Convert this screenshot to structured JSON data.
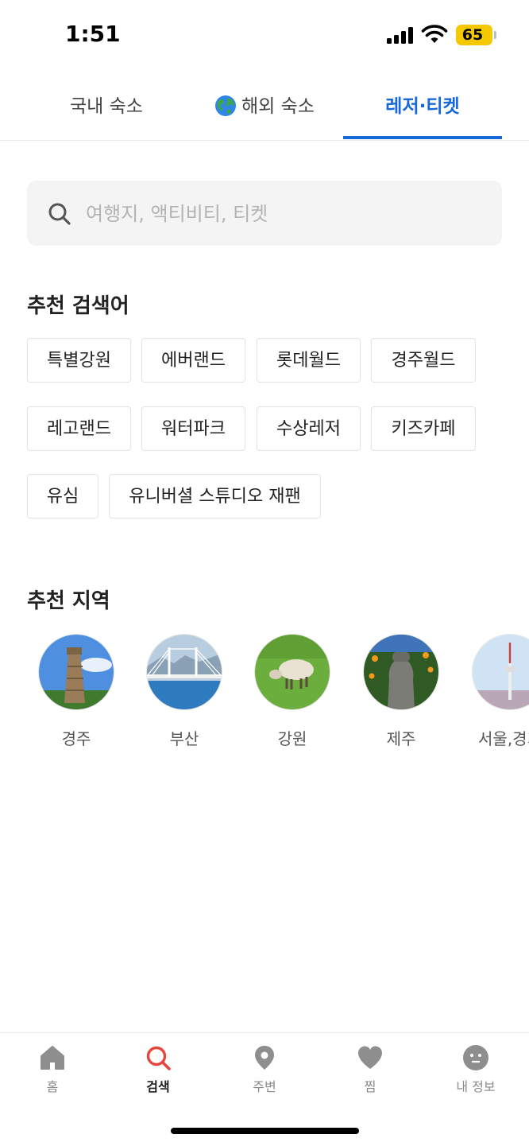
{
  "status_bar": {
    "time": "1:51",
    "battery": "65"
  },
  "tabs": [
    {
      "label": "국내 숙소",
      "active": false
    },
    {
      "label": "해외 숙소",
      "icon": "globe-icon",
      "active": false
    },
    {
      "label": "레저·티켓",
      "active": true
    }
  ],
  "search": {
    "placeholder": "여행지, 액티비티, 티켓",
    "value": ""
  },
  "recommended_keywords": {
    "title": "추천 검색어",
    "items": [
      "특별강원",
      "에버랜드",
      "롯데월드",
      "경주월드",
      "레고랜드",
      "워터파크",
      "수상레저",
      "키즈카페",
      "유심",
      "유니버셜 스튜디오 재팬"
    ]
  },
  "recommended_regions": {
    "title": "추천 지역",
    "items": [
      "경주",
      "부산",
      "강원",
      "제주",
      "서울,경기"
    ]
  },
  "bottom_nav": [
    {
      "label": "홈",
      "icon": "home-icon",
      "active": false
    },
    {
      "label": "검색",
      "icon": "search-icon",
      "active": true
    },
    {
      "label": "주변",
      "icon": "location-pin-icon",
      "active": false
    },
    {
      "label": "찜",
      "icon": "heart-icon",
      "active": false
    },
    {
      "label": "내 정보",
      "icon": "profile-face-icon",
      "active": false
    }
  ],
  "colors": {
    "accent": "#1769d9",
    "nav_active": "#e8453c",
    "battery": "#f6c800"
  }
}
